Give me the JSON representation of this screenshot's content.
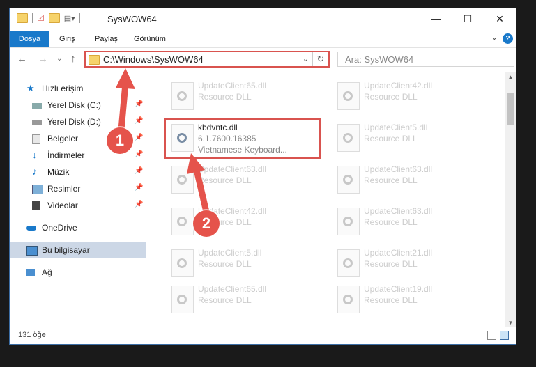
{
  "window": {
    "title": "SysWOW64",
    "minimize_glyph": "—",
    "maximize_glyph": "☐",
    "close_glyph": "✕"
  },
  "ribbon": {
    "tabs": [
      "Dosya",
      "Giriş",
      "Paylaş",
      "Görünüm"
    ],
    "help_label": "?"
  },
  "navbar": {
    "address": "C:\\Windows\\SysWOW64",
    "search_placeholder": "Ara: SysWOW64"
  },
  "sidebar": {
    "items": [
      {
        "label": "Hızlı erişim",
        "icon": "star-icon",
        "pinned": false
      },
      {
        "label": "Yerel Disk (C:)",
        "icon": "drive-icon",
        "pinned": true
      },
      {
        "label": "Yerel Disk (D:)",
        "icon": "drive-icon",
        "pinned": true
      },
      {
        "label": "Belgeler",
        "icon": "documents-icon",
        "pinned": true
      },
      {
        "label": "İndirmeler",
        "icon": "download-icon",
        "pinned": true
      },
      {
        "label": "Müzik",
        "icon": "music-icon",
        "pinned": true
      },
      {
        "label": "Resimler",
        "icon": "pictures-icon",
        "pinned": true
      },
      {
        "label": "Videolar",
        "icon": "video-icon",
        "pinned": true
      },
      {
        "label": "OneDrive",
        "icon": "cloud-icon",
        "pinned": false
      },
      {
        "label": "Bu bilgisayar",
        "icon": "computer-icon",
        "pinned": false,
        "selected": true
      },
      {
        "label": "Ağ",
        "icon": "network-icon",
        "pinned": false
      }
    ]
  },
  "files": {
    "main": {
      "name": "kbdvntc.dll",
      "version": "6.1.7600.16385",
      "desc": "Vietnamese Keyboard..."
    },
    "left": [
      {
        "name": "UpdateClient65.dll",
        "type": "Resource DLL"
      },
      {
        "name": "UpdateClient63.dll",
        "type": "Resource DLL"
      },
      {
        "name": "UpdateClient42.dll",
        "type": "Resource DLL"
      },
      {
        "name": "UpdateClient5.dll",
        "type": "Resource DLL"
      },
      {
        "name": "UpdateClient65.dll",
        "type": "Resource DLL"
      }
    ],
    "right": [
      {
        "name": "UpdateClient42.dll",
        "type": "Resource DLL"
      },
      {
        "name": "UpdateClient5.dll",
        "type": "Resource DLL"
      },
      {
        "name": "UpdateClient63.dll",
        "type": "Resource DLL"
      },
      {
        "name": "UpdateClient63.dll",
        "type": "Resource DLL"
      },
      {
        "name": "UpdateClient21.dll",
        "type": "Resource DLL"
      },
      {
        "name": "UpdateClient19.dll",
        "type": "Resource DLL"
      }
    ]
  },
  "status": {
    "count": "131 öğe"
  },
  "annotations": {
    "badge1": "1",
    "badge2": "2",
    "accent": "#e5534b"
  }
}
